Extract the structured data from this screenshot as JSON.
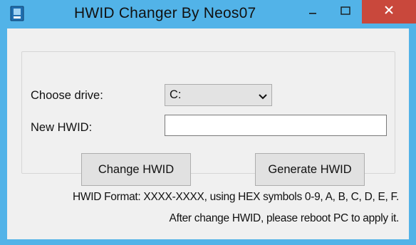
{
  "window": {
    "title": "HWID Changer By Neos07",
    "icon": "app-icon",
    "controls": [
      "minimize-icon",
      "maximize-icon",
      "close-icon"
    ],
    "colors": {
      "titlebar": "#52b3e8",
      "client": "#f0f0f0",
      "close": "#c9483c"
    }
  },
  "form": {
    "drive_label": "Choose drive:",
    "drive_value": "C:",
    "hwid_label": "New HWID:",
    "hwid_value": "",
    "change_button": "Change HWID",
    "generate_button": "Generate HWID"
  },
  "notes": {
    "format": "HWID Format: XXXX-XXXX, using HEX symbols 0-9, A, B, C, D, E, F.",
    "reboot": "After change HWID, please reboot PC to apply it."
  }
}
